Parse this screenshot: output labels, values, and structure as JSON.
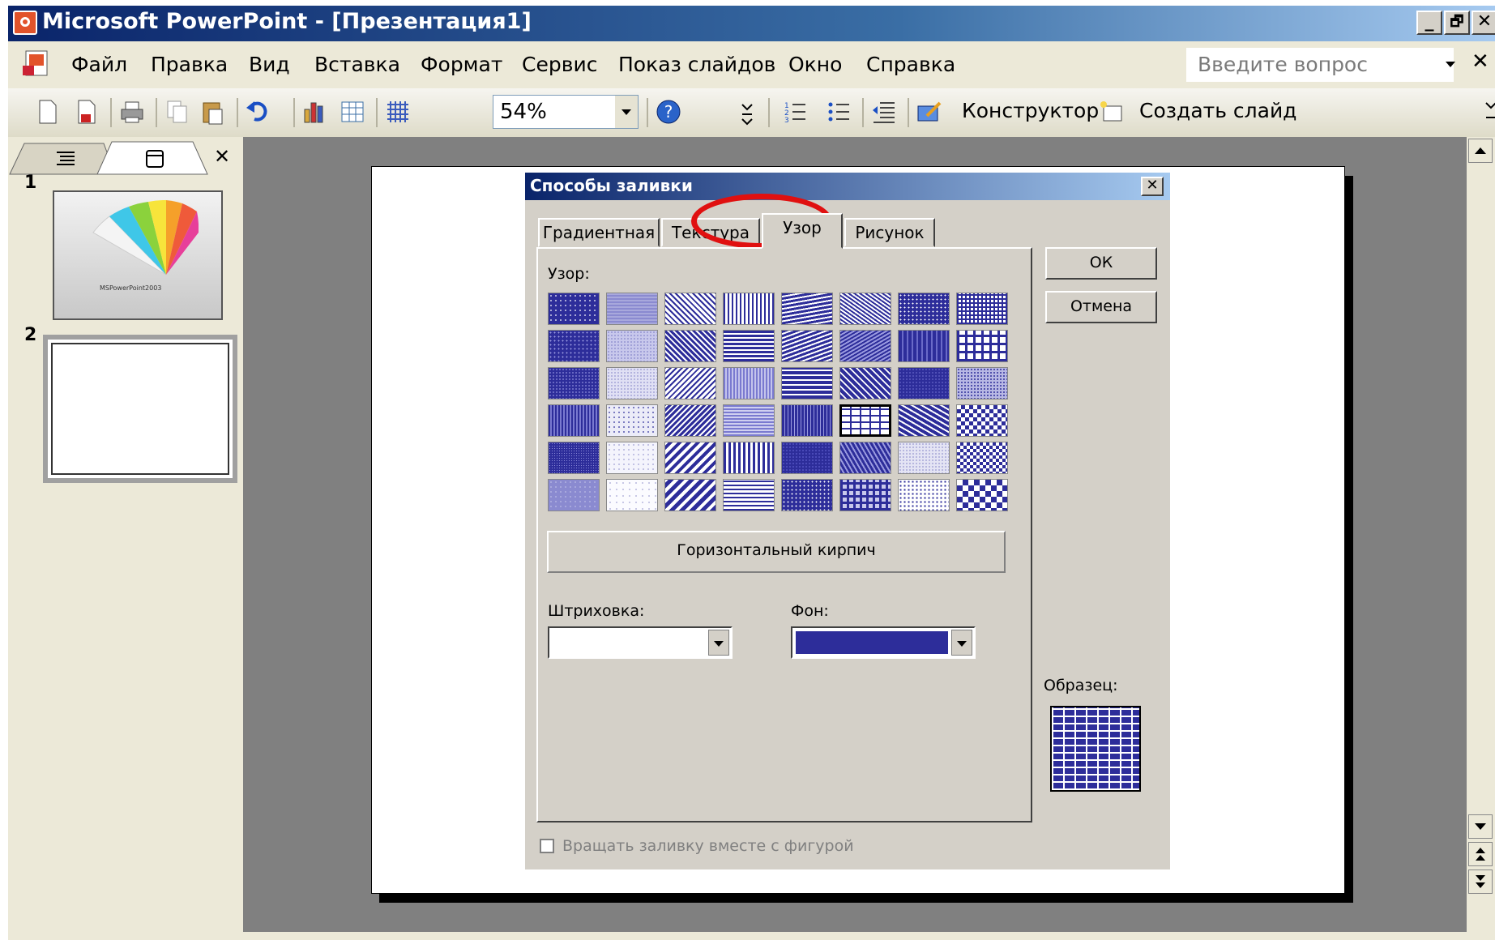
{
  "window": {
    "title": "Microsoft PowerPoint - [Презентация1]",
    "controls": [
      "_",
      "🗗",
      "✕"
    ]
  },
  "menu": {
    "items": [
      "Файл",
      "Правка",
      "Вид",
      "Вставка",
      "Формат",
      "Сервис",
      "Показ слайдов",
      "Окно",
      "Справка"
    ],
    "ask_placeholder": "Введите вопрос",
    "close_glyph": "✕"
  },
  "toolbar": {
    "zoom": "54%",
    "designer_label": "Конструктор",
    "new_slide_label": "Создать слайд"
  },
  "slides_pane": {
    "close_glyph": "✕",
    "thumbnails": [
      {
        "number": "1",
        "caption": "MSPowerPoint2003"
      },
      {
        "number": "2"
      }
    ]
  },
  "dialog": {
    "title": "Способы заливки",
    "close_glyph": "✕",
    "tabs": [
      {
        "label": "Градиентная",
        "active": false
      },
      {
        "label": "Текстура",
        "active": false
      },
      {
        "label": "Узор",
        "active": true
      },
      {
        "label": "Рисунок",
        "active": false
      }
    ],
    "pattern_label": "Узор:",
    "selected_pattern_name": "Горизонтальный кирпич",
    "hatching_label": "Штриховка:",
    "background_label": "Фон:",
    "sample_label": "Образец:",
    "ok_label": "ОК",
    "cancel_label": "Отмена",
    "rotate_label": "Вращать заливку вместе с фигурой",
    "hatch_color": "#ffffff",
    "background_color": "#2d2d9a",
    "grid_rows": 6,
    "grid_cols": 8,
    "selected_cell": {
      "row": 3,
      "col": 5
    }
  }
}
